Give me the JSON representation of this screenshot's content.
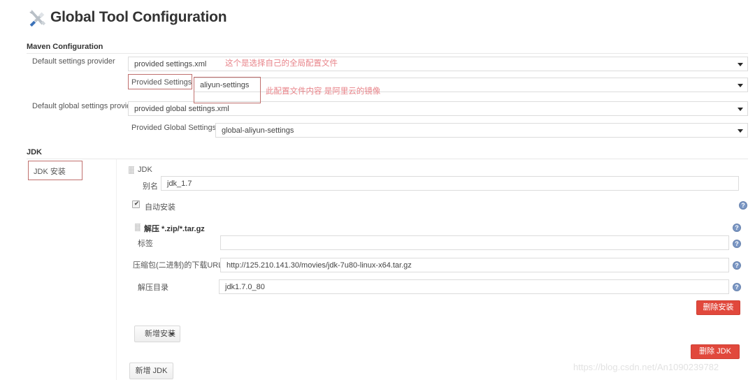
{
  "page": {
    "title": "Global Tool Configuration",
    "title_icon": "tools-icon",
    "watermark": "https://blog.csdn.net/An1090239782"
  },
  "colors": {
    "annotation_border": "#c0706e",
    "annotation_text": "#e8848a",
    "danger_button": "#e1483c",
    "help_icon": "#7b97c4",
    "field_border": "#dcdcdc"
  },
  "maven": {
    "section_label": "Maven Configuration",
    "rows": [
      {
        "label": "Default settings provider",
        "control": "select",
        "value": "provided settings.xml"
      },
      {
        "label": "Provided Settings",
        "control": "select",
        "value": "aliyun-settings"
      },
      {
        "label": "Default global settings provider",
        "control": "select",
        "value": "provided global settings.xml"
      },
      {
        "label": "Provided Global Settings",
        "control": "select",
        "value": "global-aliyun-settings"
      }
    ],
    "annotations": [
      {
        "text": "这个是选择自己的全局配置文件"
      },
      {
        "text": "此配置文件内容 是阿里云的镜像"
      }
    ]
  },
  "jdk": {
    "section_label": "JDK",
    "install_tab_label": "JDK 安装",
    "installer": {
      "heading": "JDK",
      "alias_label": "别名",
      "alias_value": "jdk_1.7",
      "auto_install_label": "自动安装",
      "auto_install_checked": true,
      "extract": {
        "heading": "解压 *.zip/*.tar.gz",
        "rows": [
          {
            "label": "标签",
            "value": ""
          },
          {
            "label": "压缩包(二进制)的下载URL",
            "value": "http://125.210.141.30/movies/jdk-7u80-linux-x64.tar.gz"
          },
          {
            "label": "解压目录",
            "value": "jdk1.7.0_80"
          }
        ]
      },
      "delete_install_label": "删除安装",
      "add_install_label": "新增安装",
      "delete_jdk_label": "删除 JDK",
      "add_jdk_label": "新增 JDK"
    },
    "help_icon_glyph": "?"
  }
}
